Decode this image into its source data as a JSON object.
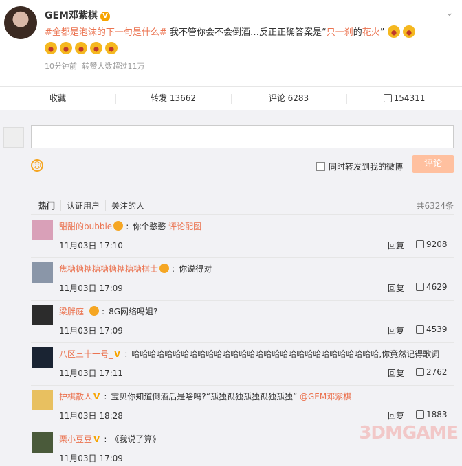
{
  "post": {
    "username": "GEM邓紫棋",
    "badge": "V",
    "topic": "#全都是泡沫的下一句是什么#",
    "text_pre": "我不管你会不会倒酒…反正正确答案是",
    "text_quote_open": "“",
    "text_hl1": "只一刹",
    "text_mid": "的",
    "text_hl2": "花火",
    "text_quote_close": "”",
    "time": "10分钟前",
    "reposts_note": "转赞人数超过11万"
  },
  "actions": [
    {
      "label": "收藏"
    },
    {
      "label": "转发 13662"
    },
    {
      "label": "评论 6283"
    },
    {
      "label": "154311"
    }
  ],
  "compose": {
    "placeholder": "",
    "forward_label": "同时转发到我的微博",
    "submit_label": "评论"
  },
  "tabs": [
    {
      "label": "热门"
    },
    {
      "label": "认证用户"
    },
    {
      "label": "关注的人"
    }
  ],
  "total": "共6324条",
  "comments": [
    {
      "user": "甜甜的bubble",
      "text": "你个憨憨",
      "link": "评论配图",
      "time": "11月03日 17:10",
      "reply": "回复",
      "likes": "9208"
    },
    {
      "user": "焦糖糖糖糖糖糖糖糖糖棋士",
      "text": "你说得对",
      "time": "11月03日 17:09",
      "reply": "回复",
      "likes": "4629"
    },
    {
      "user": "梁胖庭_",
      "text": "8G网络吗姐?",
      "time": "11月03日 17:09",
      "reply": "回复",
      "likes": "4539"
    },
    {
      "user": "八区三十一号_",
      "text": "哈哈哈哈哈哈哈哈哈哈哈哈哈哈哈哈哈哈哈哈哈哈哈哈哈哈哈哈哈哈,你竟然记得歌词",
      "time": "11月03日 17:11",
      "reply": "回复",
      "likes": "2762"
    },
    {
      "user": "护棋散人",
      "text": "宝贝你知道倒酒后是啥吗?“孤独孤独孤独孤独孤独”",
      "mention": "@GEM邓紫棋",
      "time": "11月03日 18:28",
      "reply": "回复",
      "likes": "1883"
    },
    {
      "user": "栗小豆豆",
      "text": "《我说了算》",
      "time": "11月03日 17:09",
      "reply": "",
      "likes": ""
    }
  ],
  "watermark": "3DMGAME"
}
